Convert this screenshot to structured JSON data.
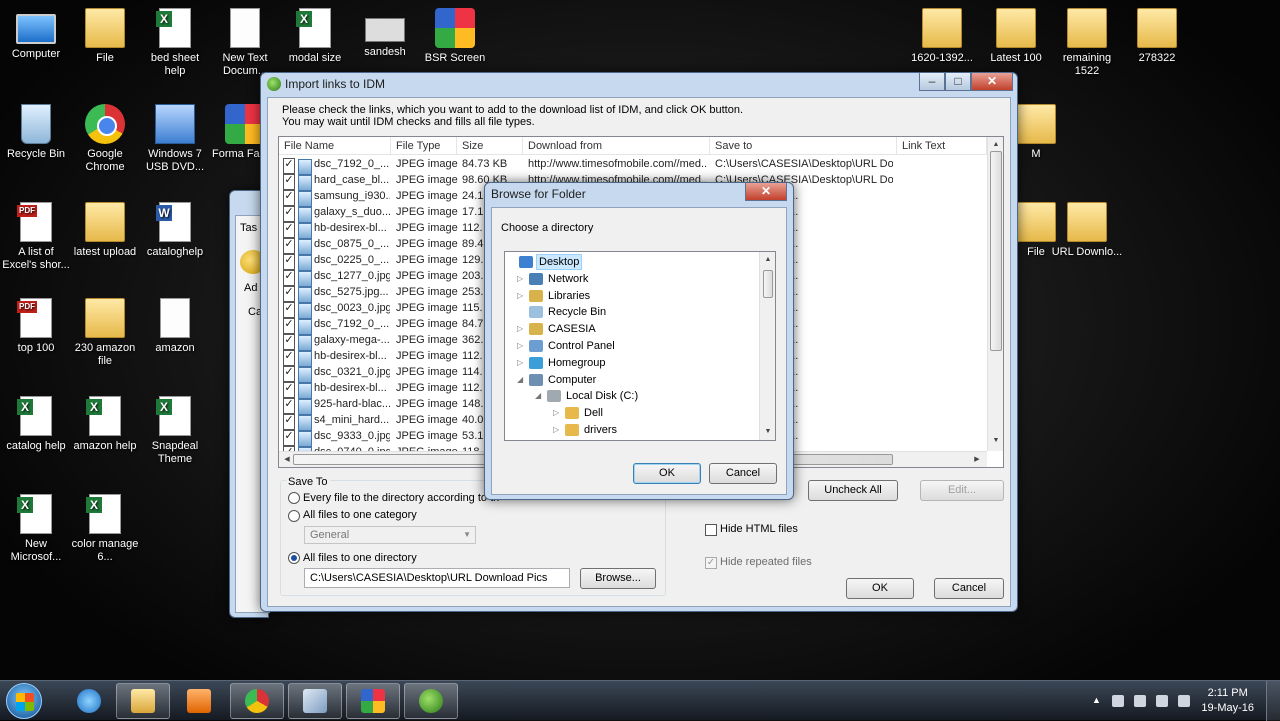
{
  "desktop_icons": [
    {
      "label": "Computer",
      "icon": "computer-icon"
    },
    {
      "label": "File",
      "icon": "folder-icon"
    },
    {
      "label": "bed sheet help",
      "icon": "excel-icon"
    },
    {
      "label": "New Text Docum...",
      "icon": "text-doc-icon"
    },
    {
      "label": "modal size",
      "icon": "excel-icon"
    },
    {
      "label": "sandesh",
      "icon": "device-icon"
    },
    {
      "label": "BSR Screen",
      "icon": "app-icon"
    },
    {
      "label": "1620-1392...",
      "icon": "folder-icon"
    },
    {
      "label": "Latest 100",
      "icon": "folder-icon"
    },
    {
      "label": "remaining 1522",
      "icon": "folder-icon"
    },
    {
      "label": "278322",
      "icon": "folder-icon"
    },
    {
      "label": "Recycle Bin",
      "icon": "recycle-bin-icon"
    },
    {
      "label": "Google Chrome",
      "icon": "chrome-icon"
    },
    {
      "label": "Windows 7 USB DVD...",
      "icon": "setup-icon"
    },
    {
      "label": "Forma Factor",
      "icon": "app-icon"
    },
    {
      "label": "A list of Excel's shor...",
      "icon": "pdf-icon"
    },
    {
      "label": "latest upload",
      "icon": "folder-icon"
    },
    {
      "label": "cataloghelp",
      "icon": "word-icon"
    },
    {
      "label": "URL Downlo...",
      "icon": "folder-icon"
    },
    {
      "label": "File",
      "icon": "folder-icon"
    },
    {
      "label": "M",
      "icon": "folder-icon"
    },
    {
      "label": "top 100",
      "icon": "pdf-icon"
    },
    {
      "label": "230 amazon file",
      "icon": "folder-icon"
    },
    {
      "label": "amazon",
      "icon": "text-doc-icon"
    },
    {
      "label": "catalog help",
      "icon": "excel-icon"
    },
    {
      "label": "amazon help",
      "icon": "excel-icon"
    },
    {
      "label": "Snapdeal Theme",
      "icon": "excel-icon"
    },
    {
      "label": "New Microsof...",
      "icon": "excel-icon"
    },
    {
      "label": "color manage 6...",
      "icon": "excel-icon"
    }
  ],
  "import_dialog": {
    "title": "Import links to IDM",
    "instructions": [
      "Please check the links, which you want to add to the download list of IDM, and click OK button.",
      "You may wait until IDM checks and fills all file types."
    ],
    "columns": [
      "File Name",
      "File Type",
      "Size",
      "Download from",
      "Save to",
      "Link Text"
    ],
    "rows": [
      {
        "name": "dsc_7192_0_...",
        "type": "JPEG image",
        "size": "84.73  KB",
        "from": "http://www.timesofmobile.com//med...",
        "to": "C:\\Users\\CASESIA\\Desktop\\URL  Do..."
      },
      {
        "name": "hard_case_bl...",
        "type": "JPEG image",
        "size": "98.60  KB",
        "from": "http://www.timesofmobile.com//med...",
        "to": "C:\\Users\\CASESIA\\Desktop\\URL  Do..."
      },
      {
        "name": "samsung_i930...",
        "type": "JPEG image",
        "size": "24.1",
        "from": "",
        "to": "esktop\\URL  Do..."
      },
      {
        "name": "galaxy_s_duo...",
        "type": "JPEG image",
        "size": "17.1",
        "from": "",
        "to": "esktop\\URL  Do..."
      },
      {
        "name": "hb-desirex-bl...",
        "type": "JPEG image",
        "size": "112.",
        "from": "",
        "to": "esktop\\URL  Do..."
      },
      {
        "name": "dsc_0875_0_...",
        "type": "JPEG image",
        "size": "89.4",
        "from": "",
        "to": "esktop\\URL  Do..."
      },
      {
        "name": "dsc_0225_0_...",
        "type": "JPEG image",
        "size": "129.",
        "from": "",
        "to": "esktop\\URL  Do..."
      },
      {
        "name": "dsc_1277_0.jpg",
        "type": "JPEG image",
        "size": "203.",
        "from": "",
        "to": "esktop\\URL  Do..."
      },
      {
        "name": "dsc_5275.jpg...",
        "type": "JPEG image",
        "size": "253.",
        "from": "",
        "to": "esktop\\URL  Do..."
      },
      {
        "name": "dsc_0023_0.jpg",
        "type": "JPEG image",
        "size": "115.",
        "from": "",
        "to": "esktop\\URL  Do..."
      },
      {
        "name": "dsc_7192_0_...",
        "type": "JPEG image",
        "size": "84.7",
        "from": "",
        "to": "esktop\\URL  Do..."
      },
      {
        "name": "galaxy-mega-...",
        "type": "JPEG image",
        "size": "362.",
        "from": "",
        "to": "esktop\\URL  Do..."
      },
      {
        "name": "hb-desirex-bl...",
        "type": "JPEG image",
        "size": "112.",
        "from": "",
        "to": "esktop\\URL  Do..."
      },
      {
        "name": "dsc_0321_0.jpg",
        "type": "JPEG image",
        "size": "114.",
        "from": "",
        "to": "esktop\\URL  Do..."
      },
      {
        "name": "hb-desirex-bl...",
        "type": "JPEG image",
        "size": "112.",
        "from": "",
        "to": "esktop\\URL  Do..."
      },
      {
        "name": "925-hard-blac...",
        "type": "JPEG image",
        "size": "148.",
        "from": "",
        "to": "esktop\\URL  Do..."
      },
      {
        "name": "s4_mini_hard...",
        "type": "JPEG image",
        "size": "40.0",
        "from": "",
        "to": "esktop\\URL  Do..."
      },
      {
        "name": "dsc_9333_0.jpg",
        "type": "JPEG image",
        "size": "53.1",
        "from": "",
        "to": "esktop\\URL  Do..."
      },
      {
        "name": "dsc_0740_0.jpg",
        "type": "JPEG image",
        "size": "118.",
        "from": "",
        "to": "esktop\\URL  Do..."
      }
    ],
    "save_to": {
      "legend": "Save To",
      "opt_every": "Every file to the directory according to th",
      "opt_category": "All files to one category",
      "category_value": "General",
      "opt_directory": "All files to one directory",
      "directory_value": "C:\\Users\\CASESIA\\Desktop\\URL  Download Pics",
      "browse": "Browse..."
    },
    "uncheck_all": "Uncheck All",
    "edit": "Edit...",
    "hide_html": "Hide HTML files",
    "hide_repeated": "Hide repeated files",
    "ok": "OK",
    "cancel": "Cancel"
  },
  "browse_dialog": {
    "title": "Browse for Folder",
    "prompt": "Choose a directory",
    "tree": [
      {
        "label": "Desktop",
        "selected": true
      },
      {
        "label": "Network"
      },
      {
        "label": "Libraries"
      },
      {
        "label": "Recycle Bin"
      },
      {
        "label": "CASESIA"
      },
      {
        "label": "Control Panel"
      },
      {
        "label": "Homegroup"
      },
      {
        "label": "Computer"
      },
      {
        "label": "Local Disk (C:)"
      },
      {
        "label": "Dell"
      },
      {
        "label": "drivers"
      }
    ],
    "ok": "OK",
    "cancel": "Cancel"
  },
  "background_window": {
    "fragments": [
      "Tas",
      "Ad",
      "Ca"
    ]
  },
  "taskbar": {
    "time": "2:11 PM",
    "date": "19-May-16"
  }
}
